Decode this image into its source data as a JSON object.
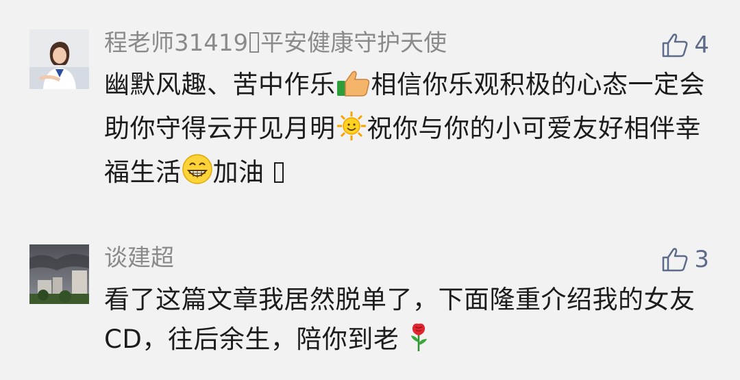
{
  "comments": [
    {
      "author_prefix": "程老师31419",
      "author_suffix": "平安健康守护天使",
      "text_1": "幽默风趣、苦中作乐",
      "text_2": "相信你乐观积极的心态一定会助你守得云开见月明",
      "text_3": "祝你与你的小可爱友好相伴幸福生活",
      "text_4": "加油 ",
      "likes": "4",
      "emojis": [
        "thumbs-up-icon",
        "sun-icon",
        "grin-icon"
      ]
    },
    {
      "author": "谈建超",
      "text": "看了这篇文章我居然脱单了，下面隆重介绍我的女友CD，往后余生，陪你到老 ",
      "likes": "3",
      "emojis": [
        "rose-icon"
      ]
    }
  ],
  "colors": {
    "background": "#f2f2f2",
    "author": "#8a8a8a",
    "text": "#1c1c1c",
    "like": "#5c6b8a"
  }
}
